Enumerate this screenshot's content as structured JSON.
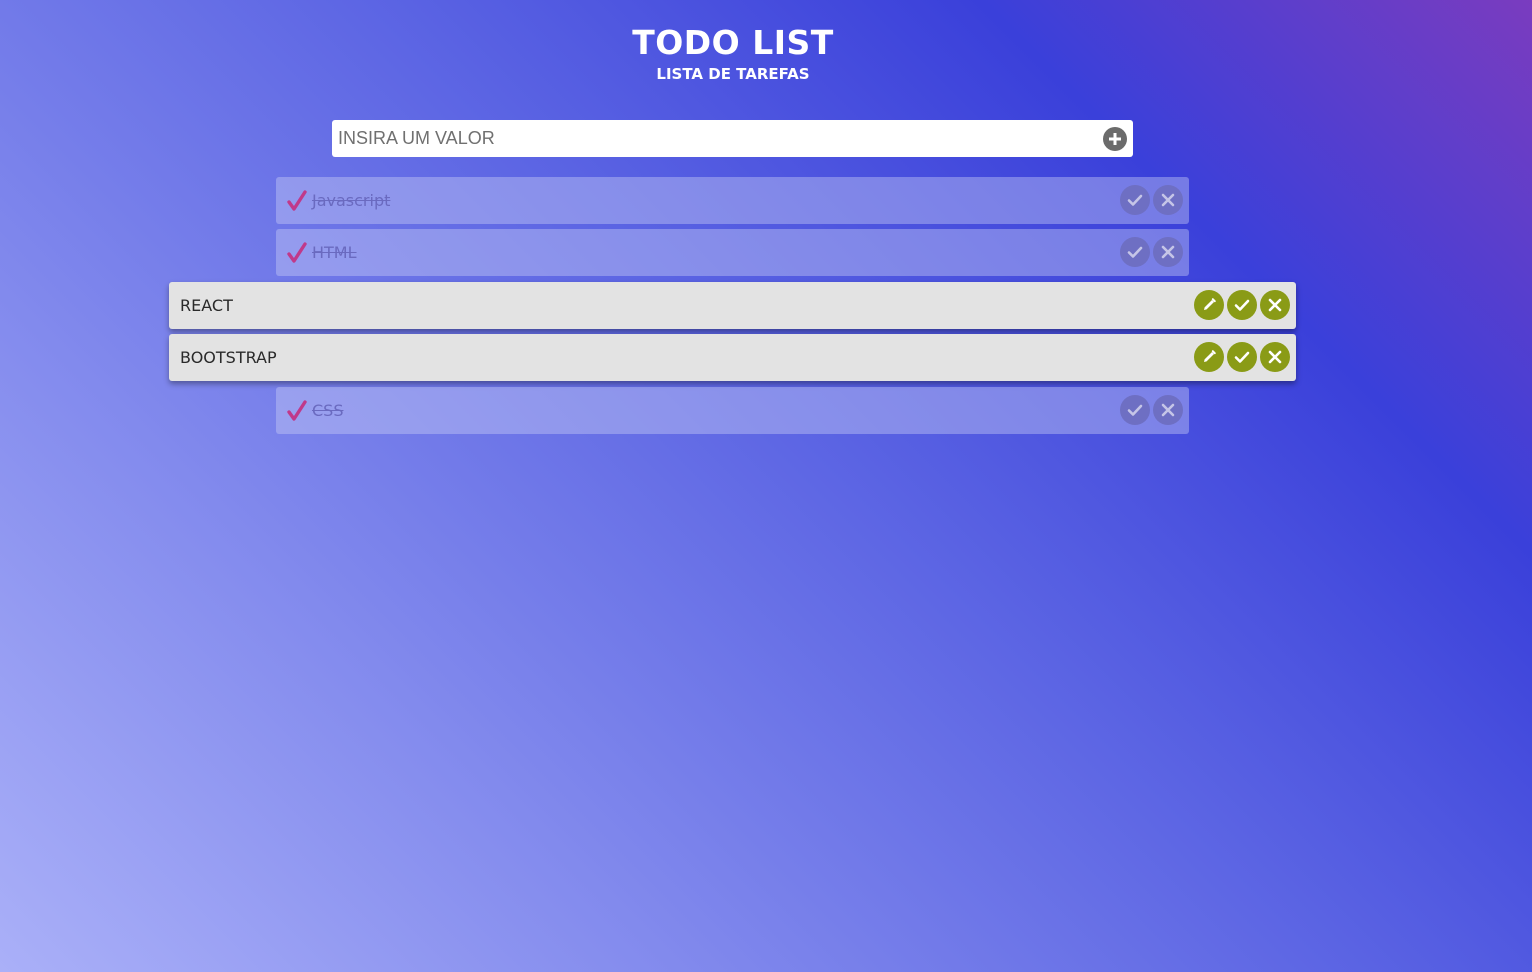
{
  "header": {
    "title": "TODO LIST",
    "subtitle": "LISTA DE TAREFAS"
  },
  "input": {
    "placeholder": "INSIRA UM VALOR",
    "value": "",
    "add_icon": "plus-circle-icon"
  },
  "tasks": [
    {
      "label": "Javascript",
      "status": "done"
    },
    {
      "label": "HTML",
      "status": "done"
    },
    {
      "label": "REACT",
      "status": "active"
    },
    {
      "label": "BOOTSTRAP",
      "status": "active"
    },
    {
      "label": "CSS",
      "status": "done"
    }
  ],
  "icons": {
    "done_marker": "checkmark-icon",
    "edit": "pencil-icon",
    "complete": "check-icon",
    "delete": "close-icon"
  },
  "colors": {
    "active_button": "#8a9b16",
    "done_button": "#6e6fc3",
    "done_marker": "#c0398a",
    "active_row": "#e3e3e3"
  }
}
